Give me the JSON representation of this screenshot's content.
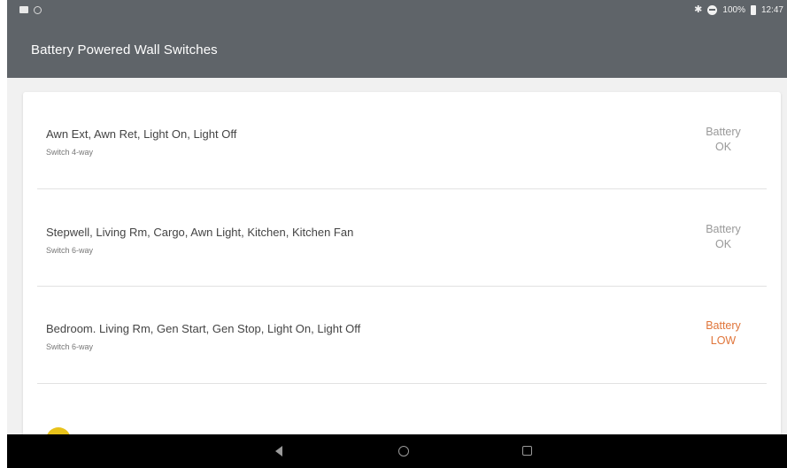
{
  "status_bar": {
    "battery_percent": "100%",
    "time": "12:47"
  },
  "app_bar": {
    "title": "Battery Powered Wall Switches"
  },
  "switches": [
    {
      "name": "Awn Ext, Awn Ret, Light On, Light Off",
      "type": "Switch 4-way",
      "status_label": "Battery",
      "status_value": "OK"
    },
    {
      "name": "Stepwell, Living Rm, Cargo, Awn Light, Kitchen, Kitchen Fan",
      "type": "Switch 6-way",
      "status_label": "Battery",
      "status_value": "OK"
    },
    {
      "name": "Bedroom. Living Rm, Gen Start, Gen Stop, Light On, Light Off",
      "type": "Switch 6-way",
      "status_label": "Battery",
      "status_value": "LOW"
    }
  ],
  "colors": {
    "app_bar": "#5f6469",
    "status_ok": "#999999",
    "status_low": "#e0753a",
    "fab": "#e8c21a"
  }
}
